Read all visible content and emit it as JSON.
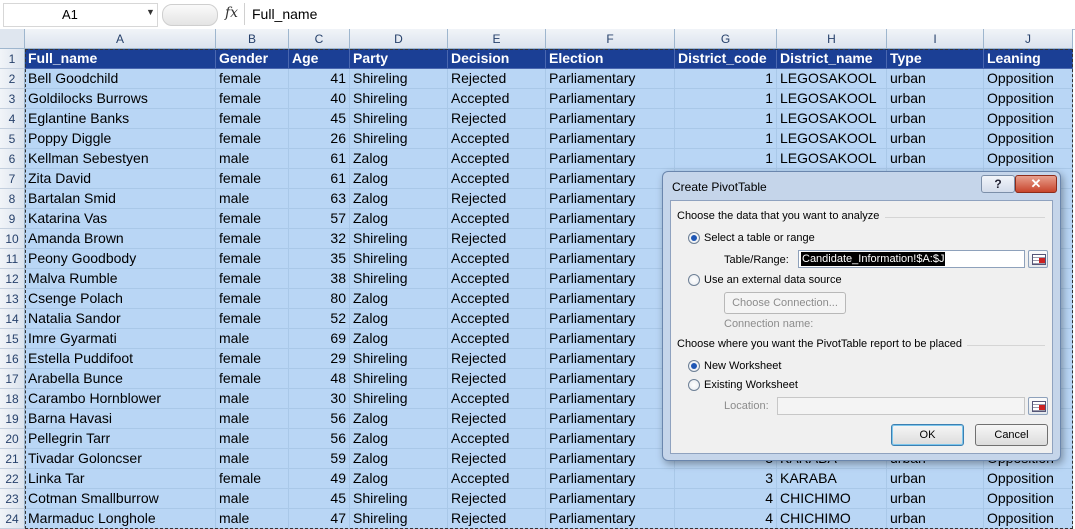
{
  "formula_bar": {
    "name_box": "A1",
    "formula": "Full_name",
    "fx_label": "fx"
  },
  "columns": [
    "A",
    "B",
    "C",
    "D",
    "E",
    "F",
    "G",
    "H",
    "I",
    "J"
  ],
  "headers": [
    "Full_name",
    "Gender",
    "Age",
    "Party",
    "Decision",
    "Election",
    "District_code",
    "District_name",
    "Type",
    "Leaning"
  ],
  "rows": [
    [
      "Bell Goodchild",
      "female",
      "41",
      "Shireling",
      "Rejected",
      "Parliamentary",
      "1",
      "LEGOSAKOOL",
      "urban",
      "Opposition"
    ],
    [
      "Goldilocks Burrows",
      "female",
      "40",
      "Shireling",
      "Accepted",
      "Parliamentary",
      "1",
      "LEGOSAKOOL",
      "urban",
      "Opposition"
    ],
    [
      "Eglantine Banks",
      "female",
      "45",
      "Shireling",
      "Rejected",
      "Parliamentary",
      "1",
      "LEGOSAKOOL",
      "urban",
      "Opposition"
    ],
    [
      "Poppy Diggle",
      "female",
      "26",
      "Shireling",
      "Accepted",
      "Parliamentary",
      "1",
      "LEGOSAKOOL",
      "urban",
      "Opposition"
    ],
    [
      "Kellman Sebestyen",
      "male",
      "61",
      "Zalog",
      "Accepted",
      "Parliamentary",
      "1",
      "LEGOSAKOOL",
      "urban",
      "Opposition"
    ],
    [
      "Zita David",
      "female",
      "61",
      "Zalog",
      "Accepted",
      "Parliamentary",
      "",
      "",
      "",
      ""
    ],
    [
      "Bartalan Smid",
      "male",
      "63",
      "Zalog",
      "Rejected",
      "Parliamentary",
      "",
      "",
      "",
      ""
    ],
    [
      "Katarina Vas",
      "female",
      "57",
      "Zalog",
      "Accepted",
      "Parliamentary",
      "",
      "",
      "",
      ""
    ],
    [
      "Amanda Brown",
      "female",
      "32",
      "Shireling",
      "Rejected",
      "Parliamentary",
      "",
      "",
      "",
      ""
    ],
    [
      "Peony Goodbody",
      "female",
      "35",
      "Shireling",
      "Accepted",
      "Parliamentary",
      "",
      "",
      "",
      ""
    ],
    [
      "Malva Rumble",
      "female",
      "38",
      "Shireling",
      "Accepted",
      "Parliamentary",
      "",
      "",
      "",
      ""
    ],
    [
      "Csenge Polach",
      "female",
      "80",
      "Zalog",
      "Accepted",
      "Parliamentary",
      "",
      "",
      "",
      ""
    ],
    [
      "Natalia Sandor",
      "female",
      "52",
      "Zalog",
      "Accepted",
      "Parliamentary",
      "",
      "",
      "",
      ""
    ],
    [
      "Imre Gyarmati",
      "male",
      "69",
      "Zalog",
      "Accepted",
      "Parliamentary",
      "",
      "",
      "",
      ""
    ],
    [
      "Estella Puddifoot",
      "female",
      "29",
      "Shireling",
      "Rejected",
      "Parliamentary",
      "",
      "",
      "",
      ""
    ],
    [
      "Arabella Bunce",
      "female",
      "48",
      "Shireling",
      "Rejected",
      "Parliamentary",
      "",
      "",
      "",
      ""
    ],
    [
      "Carambo Hornblower",
      "male",
      "30",
      "Shireling",
      "Accepted",
      "Parliamentary",
      "",
      "",
      "",
      ""
    ],
    [
      "Barna Havasi",
      "male",
      "56",
      "Zalog",
      "Rejected",
      "Parliamentary",
      "",
      "",
      "",
      ""
    ],
    [
      "Pellegrin Tarr",
      "male",
      "56",
      "Zalog",
      "Accepted",
      "Parliamentary",
      "",
      "",
      "",
      ""
    ],
    [
      "Tivadar Goloncser",
      "male",
      "59",
      "Zalog",
      "Rejected",
      "Parliamentary",
      "3",
      "KARABA",
      "urban",
      "Opposition"
    ],
    [
      "Linka Tar",
      "female",
      "49",
      "Zalog",
      "Accepted",
      "Parliamentary",
      "3",
      "KARABA",
      "urban",
      "Opposition"
    ],
    [
      "Cotman Smallburrow",
      "male",
      "45",
      "Shireling",
      "Rejected",
      "Parliamentary",
      "4",
      "CHICHIMO",
      "urban",
      "Opposition"
    ],
    [
      "Marmaduc Longhole",
      "male",
      "47",
      "Shireling",
      "Rejected",
      "Parliamentary",
      "4",
      "CHICHIMO",
      "urban",
      "Opposition"
    ]
  ],
  "dialog": {
    "title": "Create PivotTable",
    "help": "?",
    "close": "✕",
    "section1": "Choose the data that you want to analyze",
    "opt_table": "Select a table or range",
    "table_range_label": "Table/Range:",
    "table_range_value": "Candidate_Information!$A:$J",
    "opt_external": "Use an external data source",
    "choose_connection": "Choose Connection...",
    "connection_name_label": "Connection name:",
    "section2": "Choose where you want the PivotTable report to be placed",
    "opt_new": "New Worksheet",
    "opt_existing": "Existing Worksheet",
    "location_label": "Location:",
    "ok": "OK",
    "cancel": "Cancel"
  }
}
